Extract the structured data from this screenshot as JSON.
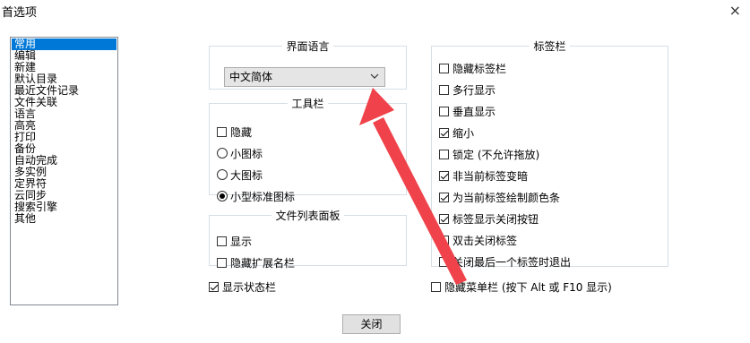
{
  "window": {
    "title": "首选项",
    "close_glyph": "×"
  },
  "categories": [
    {
      "label": "常用",
      "selected": true
    },
    {
      "label": "编辑",
      "selected": false
    },
    {
      "label": "新建",
      "selected": false
    },
    {
      "label": "默认目录",
      "selected": false
    },
    {
      "label": "最近文件记录",
      "selected": false
    },
    {
      "label": "文件关联",
      "selected": false
    },
    {
      "label": "语言",
      "selected": false
    },
    {
      "label": "高亮",
      "selected": false
    },
    {
      "label": "打印",
      "selected": false
    },
    {
      "label": "备份",
      "selected": false
    },
    {
      "label": "自动完成",
      "selected": false
    },
    {
      "label": "多实例",
      "selected": false
    },
    {
      "label": "定界符",
      "selected": false
    },
    {
      "label": "云同步",
      "selected": false
    },
    {
      "label": "搜索引擎",
      "selected": false
    },
    {
      "label": "其他",
      "selected": false
    }
  ],
  "language": {
    "legend": "界面语言",
    "selected": "中文简体"
  },
  "toolbar": {
    "legend": "工具栏",
    "hide_label": "隐藏",
    "hide_checked": false,
    "small_icons": "小图标",
    "large_icons": "大图标",
    "small_std_icons": "小型标准图标",
    "selected_option": "小型标准图标"
  },
  "file_list_panel": {
    "legend": "文件列表面板",
    "show_label": "显示",
    "show_checked": false,
    "hide_ext_label": "隐藏扩展名栏",
    "hide_ext_checked": false
  },
  "status_bar": {
    "label": "显示状态栏",
    "checked": true
  },
  "tabbar": {
    "legend": "标签栏",
    "options": [
      {
        "label": "隐藏标签栏",
        "checked": false
      },
      {
        "label": "多行显示",
        "checked": false
      },
      {
        "label": "垂直显示",
        "checked": false
      },
      {
        "label": "缩小",
        "checked": true
      },
      {
        "label": "锁定 (不允许拖放)",
        "checked": false
      },
      {
        "label": "非当前标签变暗",
        "checked": true
      },
      {
        "label": "为当前标签绘制颜色条",
        "checked": true
      },
      {
        "label": "标签显示关闭按钮",
        "checked": true
      },
      {
        "label": "双击关闭标签",
        "checked": false
      },
      {
        "label": "关闭最后一个标签时退出",
        "checked": false
      }
    ]
  },
  "menu_bar": {
    "label": "隐藏菜单栏 (按下 Alt 或 F10 显示)",
    "checked": false
  },
  "close_button": "关闭",
  "annotation": {
    "arrow_color": "#f0424a"
  }
}
